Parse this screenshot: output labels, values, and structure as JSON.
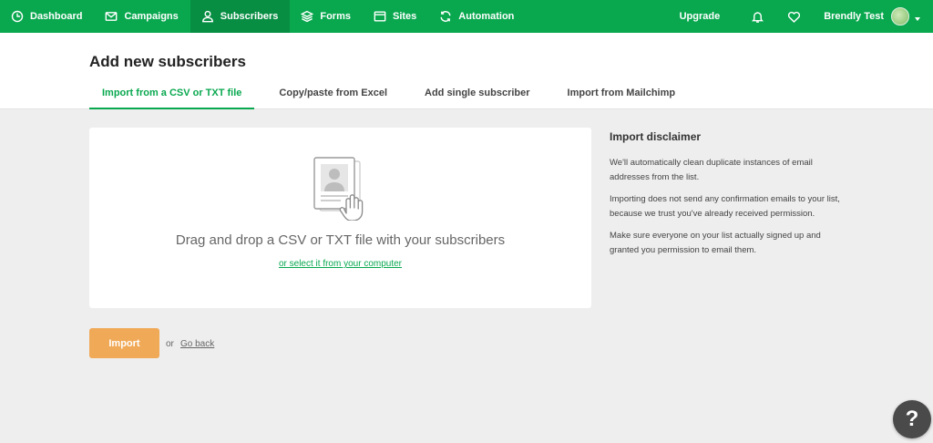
{
  "nav": {
    "items": [
      {
        "label": "Dashboard",
        "icon": "dashboard-icon",
        "active": false
      },
      {
        "label": "Campaigns",
        "icon": "mail-icon",
        "active": false
      },
      {
        "label": "Subscribers",
        "icon": "user-icon",
        "active": true
      },
      {
        "label": "Forms",
        "icon": "layers-icon",
        "active": false
      },
      {
        "label": "Sites",
        "icon": "window-icon",
        "active": false
      },
      {
        "label": "Automation",
        "icon": "refresh-icon",
        "active": false
      }
    ],
    "upgrade": "Upgrade",
    "user_name": "Brendly Test"
  },
  "header": {
    "title": "Add new subscribers",
    "tabs": [
      {
        "label": "Import from a CSV or TXT file",
        "active": true
      },
      {
        "label": "Copy/paste from Excel",
        "active": false
      },
      {
        "label": "Add single subscriber",
        "active": false
      },
      {
        "label": "Import from Mailchimp",
        "active": false
      }
    ]
  },
  "dropzone": {
    "icon": "document-hand-icon",
    "text": "Drag and drop a CSV or TXT file with your subscribers",
    "link": "or select it from your computer"
  },
  "disclaimer": {
    "title": "Import disclaimer",
    "paragraphs": [
      "We'll automatically clean duplicate instances of email addresses from the list.",
      "Importing does not send any confirmation emails to your list, because we trust you've already received permission.",
      "Make sure everyone on your list actually signed up and granted you permission to email them."
    ]
  },
  "actions": {
    "import_label": "Import",
    "or": "or",
    "go_back": "Go back"
  },
  "help": {
    "label": "?"
  },
  "colors": {
    "brand_green": "#09a84f",
    "active_nav": "#078e43",
    "import_orange": "#f0a957",
    "help_dark": "#4a4a4a"
  }
}
